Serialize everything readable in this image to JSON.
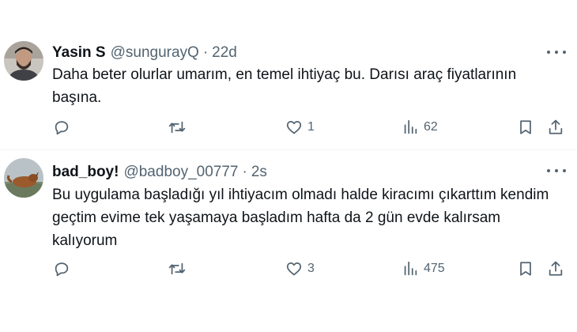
{
  "tweets": [
    {
      "author_name": "Yasin S",
      "handle": "@sungurayQ",
      "separator": "·",
      "time": "22d",
      "text_lines": [
        "Daha beter olurlar umarım, en temel ihtiyaç bu. Darısı araç fiyatlarının",
        "başına."
      ],
      "replies": "",
      "reposts": "",
      "likes": "1",
      "views": "62"
    },
    {
      "author_name": "bad_boy!",
      "handle": "@badboy_00777",
      "separator": "·",
      "time": "2s",
      "text_lines": [
        "Bu uygulama başladığı yıl ihtiyacım olmadı halde kiracımı çıkarttım kendim",
        "geçtim evime tek yaşamaya başladım hafta da 2 gün evde kalırsam",
        "kalıyorum"
      ],
      "replies": "",
      "reposts": "",
      "likes": "3",
      "views": "475"
    }
  ],
  "icons": {
    "reply": "reply-icon",
    "repost": "repost-icon",
    "like": "heart-icon",
    "views": "views-icon",
    "bookmark": "bookmark-icon",
    "share": "share-icon",
    "more": "more-icon"
  },
  "colors": {
    "text": "#0f1419",
    "secondary": "#536471",
    "divider": "#eff3f4"
  }
}
